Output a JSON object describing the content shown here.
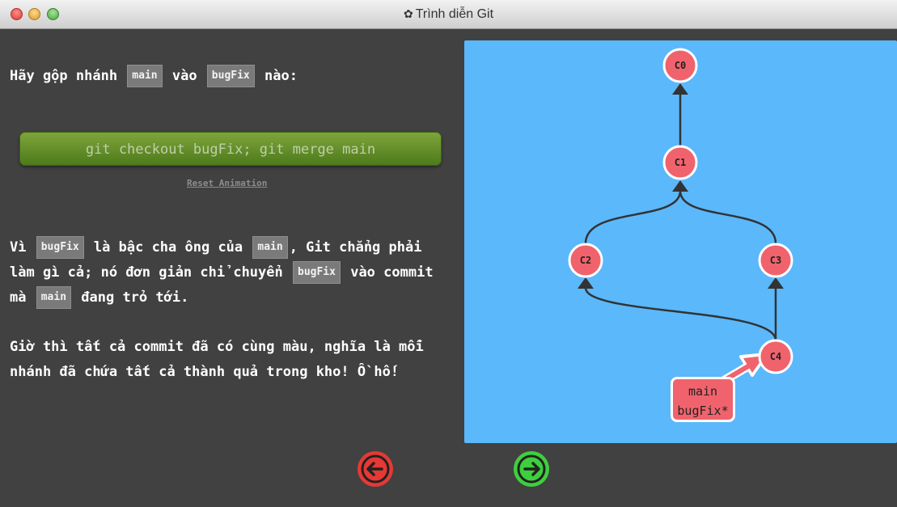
{
  "window": {
    "title": "Trình diễn Git",
    "title_icon": "gear-icon"
  },
  "lesson": {
    "intro": {
      "pre": "Hãy gộp nhánh ",
      "branch1": "main",
      "mid": " vào ",
      "branch2": "bugFix",
      "post": " nào:"
    },
    "command_button": "git checkout bugFix; git merge main",
    "reset_link": "Reset Animation",
    "explanation": {
      "t1": "Vì ",
      "b1": "bugFix",
      "t2": " là bậc cha ông của ",
      "b2": "main",
      "t3": ", Git chẳng phải làm gì cả; nó đơn giản chỉ chuyển ",
      "b3": "bugFix",
      "t4": " vào commit mà ",
      "b4": "main",
      "t5": " đang trỏ tới."
    },
    "conclusion": "Giờ thì tất cả commit đã có cùng màu, nghĩa là mỗi nhánh đã chứa tất cả thành quả trong kho! Ồ hố!"
  },
  "graph": {
    "commits": [
      "C0",
      "C1",
      "C2",
      "C3",
      "C4"
    ],
    "branch_label_lines": [
      "main",
      "bugFix*"
    ],
    "colors": {
      "background": "#5bb8fb",
      "commit_fill": "#f0636d",
      "commit_stroke": "#ffffff",
      "edge": "#333333"
    }
  },
  "nav": {
    "prev_icon": "arrow-left-icon",
    "next_icon": "arrow-right-icon",
    "prev_color": "#e53935",
    "next_color": "#3ecf3e"
  }
}
